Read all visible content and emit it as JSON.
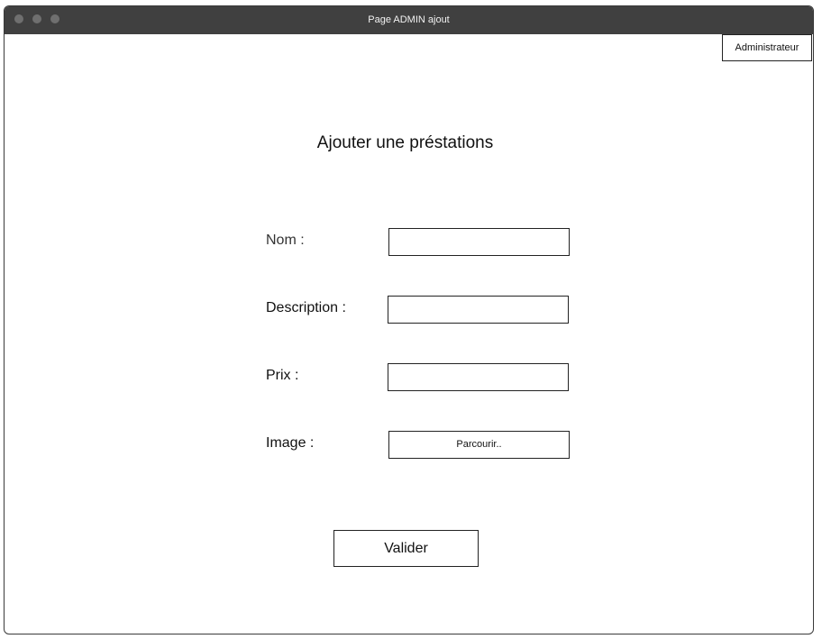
{
  "window": {
    "title": "Page ADMIN ajout"
  },
  "header": {
    "admin_label": "Administrateur"
  },
  "form": {
    "heading": "Ajouter une préstations",
    "nom_label": "Nom :",
    "nom_value": "",
    "description_label": "Description :",
    "description_value": "",
    "prix_label": "Prix :",
    "prix_value": "",
    "image_label": "Image :",
    "browse_label": "Parcourir..",
    "submit_label": "Valider"
  }
}
